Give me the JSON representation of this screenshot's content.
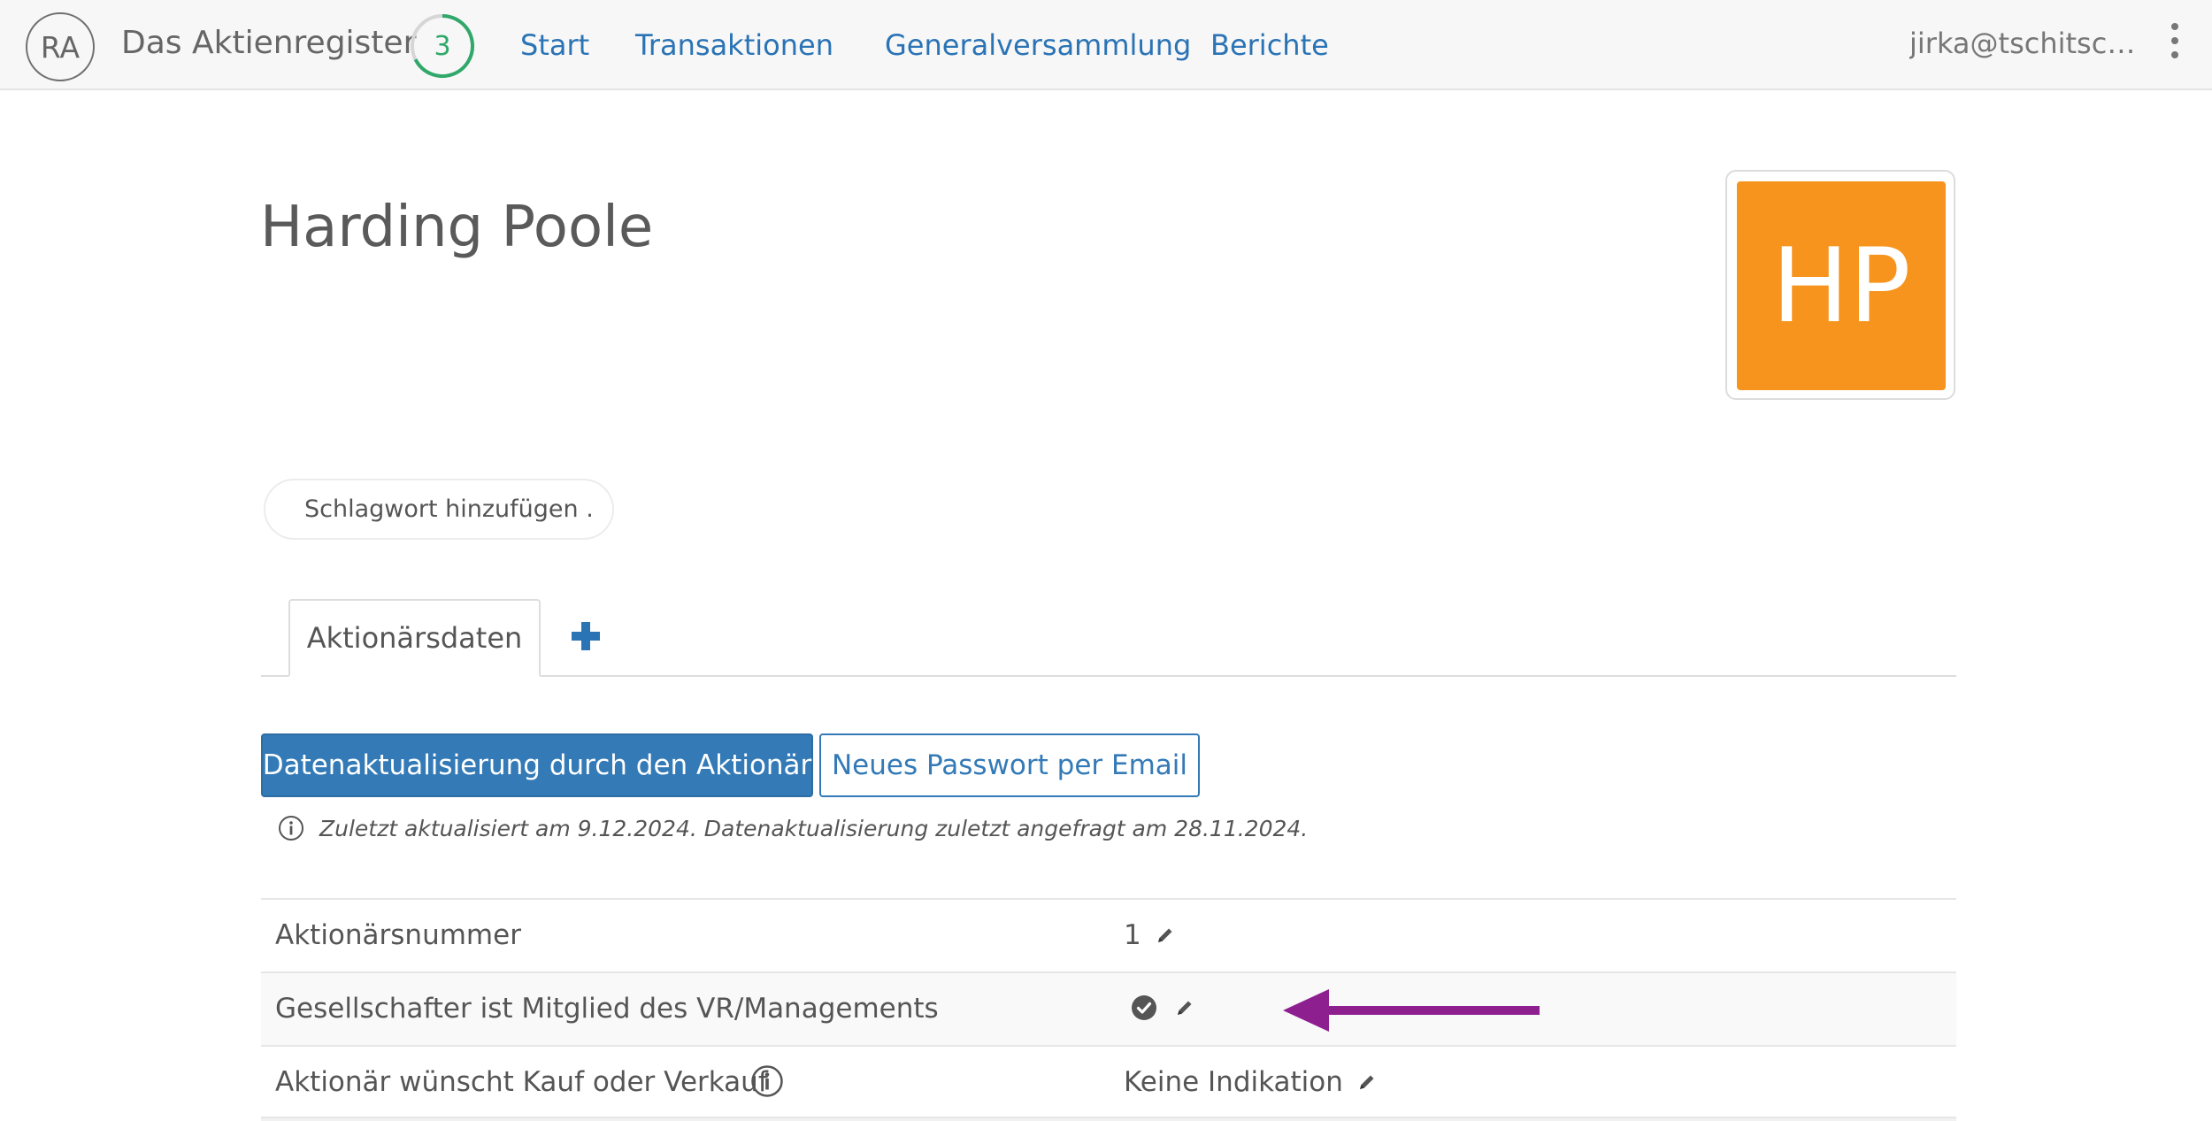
{
  "navbar": {
    "logo_initials": "RA",
    "app_name": "Das Aktienregister",
    "progress_count": "3",
    "links": [
      "Start",
      "Transaktionen",
      "Generalversammlung",
      "Berichte"
    ],
    "user_email": "jirka@tschitschereengreen.com",
    "colors": {
      "link": "#2a73b5",
      "progress": "#2fa86a"
    }
  },
  "profile": {
    "name": "Harding Poole",
    "avatar_initials": "HP",
    "avatar_color": "#f7941d"
  },
  "tags": {
    "placeholder": "Schlagwort hinzufügen ."
  },
  "tabs": {
    "active_label": "Aktionärsdaten",
    "add_icon": "plus-icon"
  },
  "actions": {
    "primary_label": "Datenaktualisierung durch den Aktionär",
    "secondary_label": "Neues Passwort per Email",
    "primary_color": "#337ab7"
  },
  "note": {
    "icon": "info-icon",
    "text": "Zuletzt aktualisiert am 9.12.2024. Datenaktualisierung zuletzt angefragt am 28.11.2024."
  },
  "rows": [
    {
      "label": "Aktionärsnummer",
      "value": "1"
    },
    {
      "label": "Gesellschafter ist Mitglied des VR/Managements",
      "value_icon": "check-circle-icon"
    },
    {
      "label": "Aktionär wünscht Kauf oder Verkauf",
      "value": "Keine Indikation",
      "label_icon": "info-icon"
    }
  ],
  "annotation": {
    "color": "#8e1f8f",
    "icon": "arrow-left-icon"
  }
}
